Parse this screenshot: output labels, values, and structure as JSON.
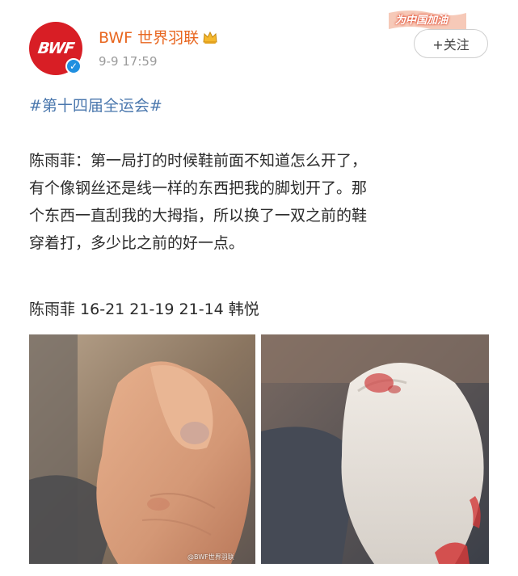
{
  "post": {
    "author": {
      "avatar_text": "BWF",
      "name": "BWF 世界羽联",
      "verified": true
    },
    "timestamp": "9-9 17:59",
    "promo_badge": "为中国加油",
    "follow_label": "+关注",
    "topic": "#第十四届全运会#",
    "body_lines": [
      "陈雨菲：第一局打的时候鞋前面不知道怎么开了，",
      "有个像钢丝还是线一样的东西把我的脚划开了。那",
      "个东西一直刮我的大拇指，所以换了一双之前的鞋",
      "穿着打，多少比之前的好一点。"
    ],
    "score_line": "陈雨菲 16-21 21-19 21-14 韩悦",
    "images": [
      {
        "subject": "injured toe",
        "watermark": "@BWF世界羽联"
      },
      {
        "subject": "bloodstained sock",
        "watermark": ""
      }
    ]
  },
  "colors": {
    "brand_red": "#d81e25",
    "username": "#e8661f",
    "topic_link": "#4a77ad",
    "verified_blue": "#1f8fe0"
  }
}
